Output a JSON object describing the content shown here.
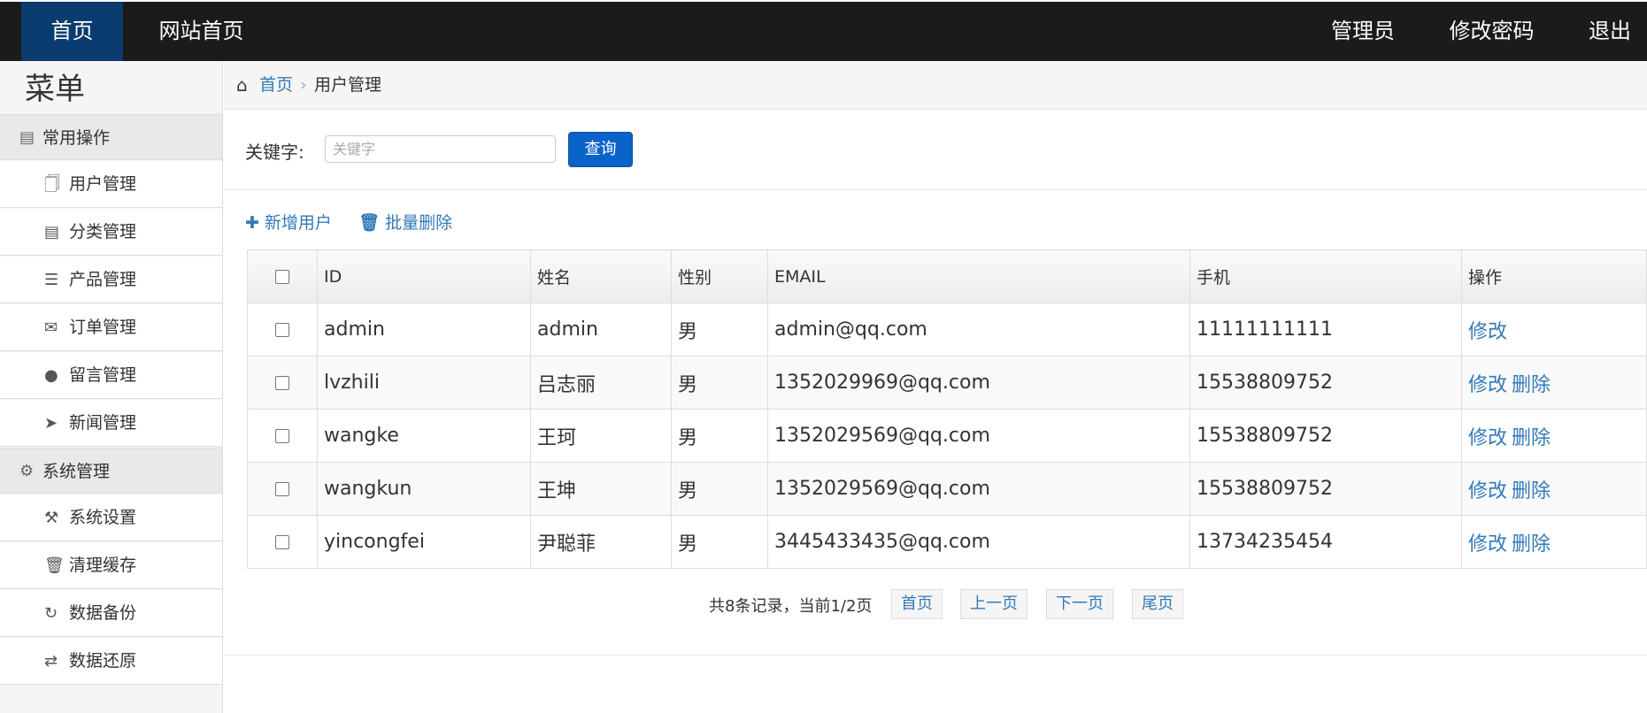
{
  "topnav": {
    "home": "首页",
    "site_home": "网站首页",
    "admin": "管理员",
    "change_password": "修改密码",
    "logout": "退出"
  },
  "sidebar": {
    "title": "菜单",
    "groups": [
      {
        "label": "常用操作",
        "icon": "address-book-icon",
        "items": [
          {
            "label": "用户管理",
            "icon": "file-icon"
          },
          {
            "label": "分类管理",
            "icon": "list-alt-icon"
          },
          {
            "label": "产品管理",
            "icon": "barcode-icon"
          },
          {
            "label": "订单管理",
            "icon": "envelope-icon"
          },
          {
            "label": "留言管理",
            "icon": "comment-icon"
          },
          {
            "label": "新闻管理",
            "icon": "bullhorn-icon"
          }
        ]
      },
      {
        "label": "系统管理",
        "icon": "gear-icon",
        "items": [
          {
            "label": "系统设置",
            "icon": "wrench-icon"
          },
          {
            "label": "清理缓存",
            "icon": "trash-icon"
          },
          {
            "label": "数据备份",
            "icon": "rotate-icon"
          },
          {
            "label": "数据还原",
            "icon": "refresh-icon"
          }
        ]
      }
    ]
  },
  "breadcrumb": {
    "home": "首页",
    "current": "用户管理"
  },
  "search": {
    "label": "关键字:",
    "placeholder": "关键字",
    "button": "查询"
  },
  "actions": {
    "add": "新增用户",
    "batch_delete": "批量删除"
  },
  "table": {
    "columns": [
      "ID",
      "姓名",
      "性别",
      "EMAIL",
      "手机",
      "操作"
    ],
    "rows": [
      {
        "id": "admin",
        "name": "admin",
        "gender": "男",
        "email": "admin@qq.com",
        "phone": "11111111111",
        "edit": "修改",
        "delete": ""
      },
      {
        "id": "lvzhili",
        "name": "吕志丽",
        "gender": "男",
        "email": "1352029969@qq.com",
        "phone": "15538809752",
        "edit": "修改",
        "delete": "删除"
      },
      {
        "id": "wangke",
        "name": "王珂",
        "gender": "男",
        "email": "1352029569@qq.com",
        "phone": "15538809752",
        "edit": "修改",
        "delete": "删除"
      },
      {
        "id": "wangkun",
        "name": "王坤",
        "gender": "男",
        "email": "1352029569@qq.com",
        "phone": "15538809752",
        "edit": "修改",
        "delete": "删除"
      },
      {
        "id": "yincongfei",
        "name": "尹聪菲",
        "gender": "男",
        "email": "3445433435@qq.com",
        "phone": "13734235454",
        "edit": "修改",
        "delete": "删除"
      }
    ]
  },
  "pager": {
    "info": "共8条记录，当前1/2页",
    "first": "首页",
    "prev": "上一页",
    "next": "下一页",
    "last": "尾页"
  },
  "colors": {
    "topbar": "#1b1b1b",
    "topbar_active": "#0a3b6e",
    "link": "#337ab7",
    "primary_button": "#0a63c9"
  }
}
